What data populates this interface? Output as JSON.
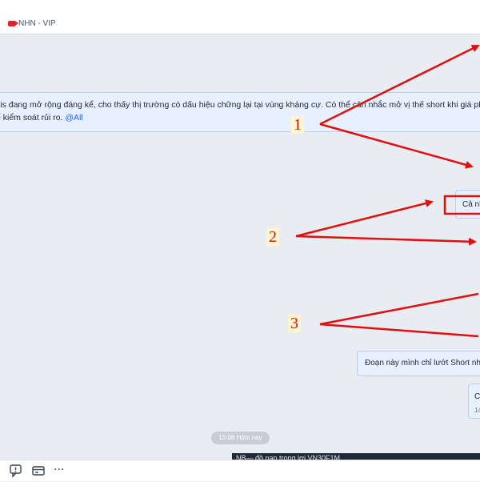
{
  "header": {
    "group_name": "NHN - VIP",
    "tag_icon": "tag-icon",
    "tag_color": "#d9262c"
  },
  "messages": {
    "m1_line1": "sis đang mở rộng đáng kể, cho thấy thị trường có dấu hiệu chững lại tại vùng kháng cự. Có thể cân nhắc mở vị thế short khi giá phản ứng tại khu",
    "m1_line2_text": "ể kiểm soát rủi ro.",
    "m1_mention": "@All",
    "m2_text": "Cả nh",
    "m3_text": "Đoạn này mình chỉ lướt Short nhẹ n",
    "m4_text": "C",
    "m4_time": "14"
  },
  "time_divider": "15:08 Hôm nay",
  "dark_strip_text": "NB— đồ nạp trong lợi VN30F1M",
  "annotations": {
    "label_1": "1",
    "label_2": "2",
    "label_3": "3",
    "arrow_color": "#e01010"
  },
  "toolbar": {
    "icons": [
      "quote-icon",
      "card-icon",
      "more-icon"
    ],
    "more_label": "···"
  },
  "colors": {
    "bubble_bg": "#e7f0fe",
    "bubble_border": "#b7cdf5",
    "mention": "#2563eb"
  }
}
